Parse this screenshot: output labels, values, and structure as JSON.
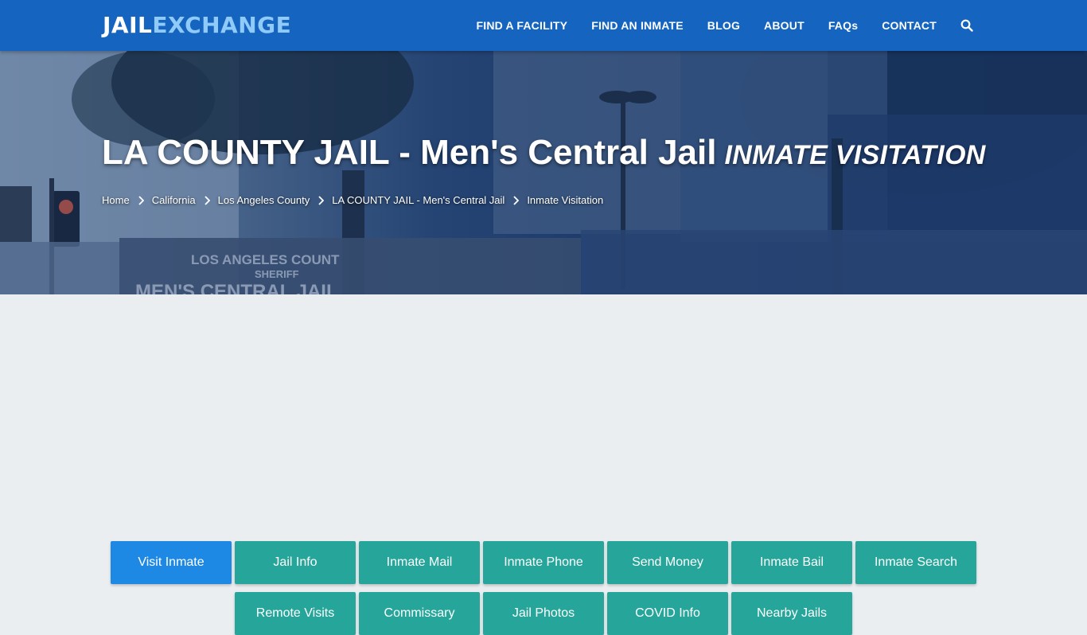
{
  "brand": {
    "part1": "JAIL",
    "part2": "EXCHANGE"
  },
  "nav": {
    "items": [
      "FIND A FACILITY",
      "FIND AN INMATE",
      "BLOG",
      "ABOUT",
      "FAQs",
      "CONTACT"
    ]
  },
  "hero": {
    "title": "LA COUNTY JAIL - Men's Central Jail",
    "subtitle": "INMATE VISITATION",
    "sign_line1": "LOS ANGELES COUNT",
    "sign_line2": "SHERIFF",
    "sign_line3": "MEN'S CENTRAL JAIL"
  },
  "breadcrumb": {
    "items": [
      "Home",
      "California",
      "Los Angeles County",
      "LA COUNTY JAIL - Men's Central Jail"
    ],
    "current": "Inmate Visitation"
  },
  "buttons": {
    "row1": [
      "Visit Inmate",
      "Jail Info",
      "Inmate Mail",
      "Inmate Phone",
      "Send Money",
      "Inmate Bail",
      "Inmate Search"
    ],
    "row2": [
      "Remote Visits",
      "Commissary",
      "Jail Photos",
      "COVID Info",
      "Nearby Jails"
    ],
    "active": "Visit Inmate"
  },
  "colors": {
    "navbar": "#1565c0",
    "button": "#26a69a",
    "button_active": "#1e88e5",
    "page_bg": "#ebeef1"
  }
}
